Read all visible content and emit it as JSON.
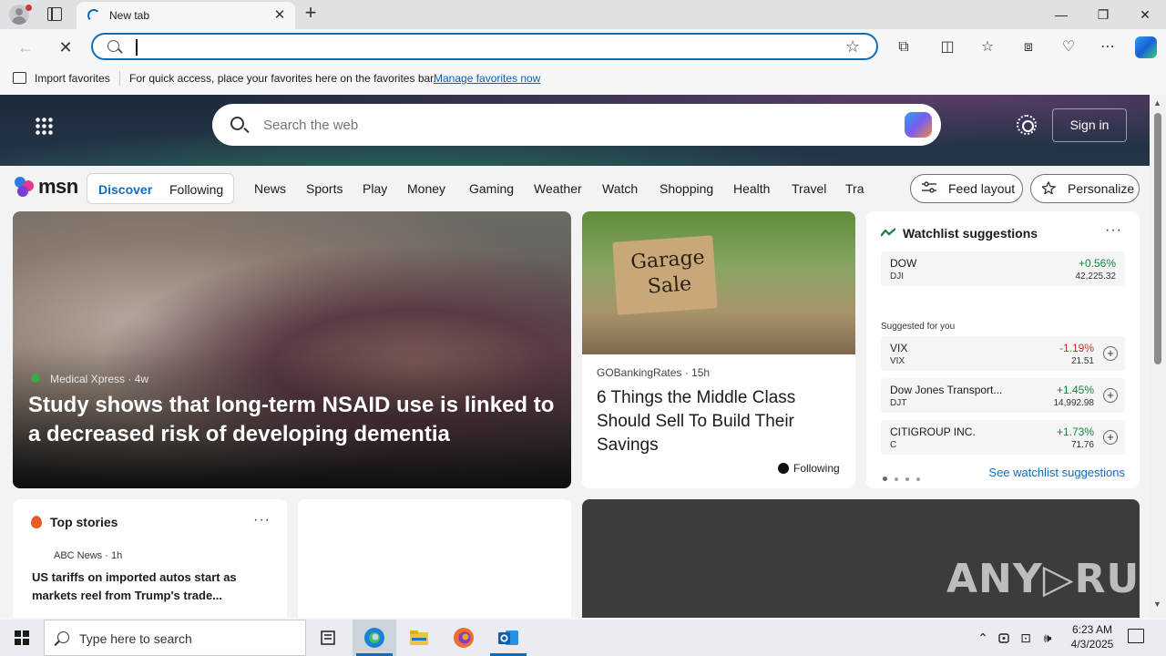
{
  "browser": {
    "tab_title": "New tab",
    "tab_close": "✕",
    "new_tab": "+",
    "window_controls": {
      "minimize": "—",
      "restore": "❐",
      "close": "✕"
    },
    "address": {
      "value": "",
      "placeholder": ""
    },
    "nav": {
      "back": "←",
      "stop": "✕",
      "favorite_star": "☆"
    },
    "toolbar_icons": [
      "extensions-icon",
      "split-screen-icon",
      "favorites-icon",
      "collections-icon",
      "browser-essentials-icon",
      "more-icon",
      "copilot-icon"
    ],
    "toolbar_glyphs": {
      "extensions": "⧉",
      "split": "◫",
      "favorites": "☆",
      "collections": "⧈",
      "essentials": "♡",
      "more": "⋯"
    },
    "favorites_bar": {
      "import_label": "Import favorites",
      "hint": "For quick access, place your favorites here on the favorites bar.",
      "manage_link": "Manage favorites now"
    }
  },
  "msn": {
    "search_placeholder": "Search the web",
    "signin": "Sign in",
    "logo_text": "msn",
    "feed_toggle": {
      "discover": "Discover",
      "following": "Following"
    },
    "categories": [
      "News",
      "Sports",
      "Play",
      "Money",
      "Gaming",
      "Weather",
      "Watch",
      "Shopping",
      "Health",
      "Travel",
      "Tra"
    ],
    "feed_layout": "Feed layout",
    "personalize": "Personalize",
    "hero": {
      "source": "Medical Xpress · 4w",
      "title": "Study shows that long-term NSAID use is linked to a decreased risk of developing dementia"
    },
    "garage": {
      "sign_text": "Garage Sale",
      "source": "GOBankingRates · 15h",
      "title": "6 Things the Middle Class Should Sell To Build Their Savings",
      "following": "Following"
    },
    "watchlist": {
      "title": "Watchlist suggestions",
      "more": "···",
      "main": {
        "name": "DOW",
        "symbol": "DJI",
        "change": "+0.56%",
        "price": "42,225.32",
        "direction": "up"
      },
      "suggested_label": "Suggested for you",
      "suggested": [
        {
          "name": "VIX",
          "symbol": "VIX",
          "change": "-1.19%",
          "price": "21.51",
          "direction": "down"
        },
        {
          "name": "Dow Jones Transport...",
          "symbol": "DJT",
          "change": "+1.45%",
          "price": "14,992.98",
          "direction": "up"
        },
        {
          "name": "CITIGROUP INC.",
          "symbol": "C",
          "change": "+1.73%",
          "price": "71.76",
          "direction": "up"
        }
      ],
      "add": "+",
      "see_more": "See watchlist suggestions"
    },
    "top_stories": {
      "title": "Top stories",
      "more": "···",
      "source": "ABC News · 1h",
      "headline": "US tariffs on imported autos start as markets reel from Trump's trade..."
    },
    "watermark": "ANY▷RUN"
  },
  "taskbar": {
    "search_placeholder": "Type here to search",
    "time": "6:23 AM",
    "date": "4/3/2025",
    "tray_glyphs": {
      "chevron": "⌃",
      "network": "⊡",
      "volume": "🕪"
    }
  },
  "colors": {
    "accent": "#0f6cbd",
    "up": "#14833b",
    "down": "#d13438"
  }
}
